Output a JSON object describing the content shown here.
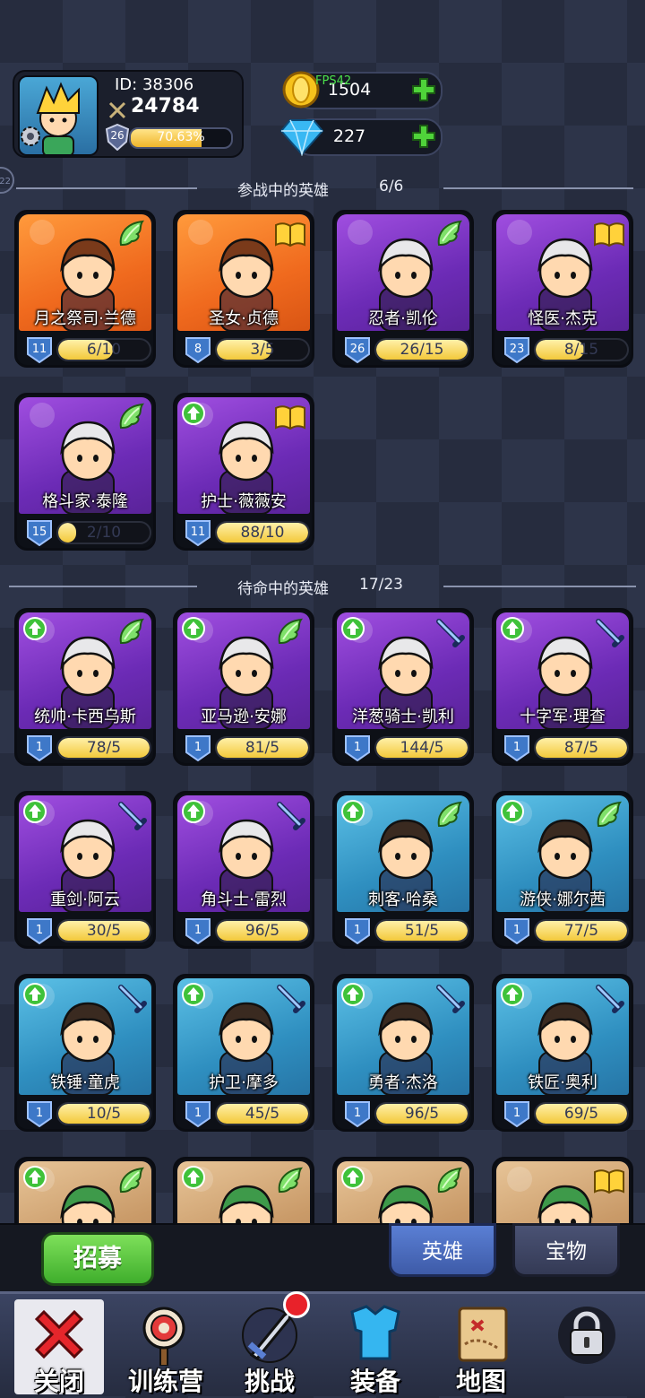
{
  "player": {
    "id_text": "ID:  38306",
    "power": "24784",
    "level": "26",
    "xp": "70.63%",
    "xp_fraction": 0.7063
  },
  "resources": {
    "gold": "1504",
    "gems": "227",
    "fps": "FPS42",
    "edge_label": "22"
  },
  "sections": {
    "active_title": "参战中的英雄",
    "active_count": "6/6",
    "standby_title": "待命中的英雄",
    "standby_count": "17/23"
  },
  "active_heroes": [
    {
      "name": "月之祭司·兰德",
      "level": "11",
      "progress": "6/10",
      "fill": 0.6,
      "bg": "orange",
      "badge": "wing",
      "up": false
    },
    {
      "name": "圣女·贞德",
      "level": "8",
      "progress": "3/5",
      "fill": 0.6,
      "bg": "orange",
      "badge": "book",
      "up": false
    },
    {
      "name": "忍者·凯伦",
      "level": "26",
      "progress": "26/15",
      "fill": 1,
      "bg": "purple",
      "badge": "wing",
      "up": false
    },
    {
      "name": "怪医·杰克",
      "level": "23",
      "progress": "8/15",
      "fill": 0.53,
      "bg": "purple",
      "badge": "book",
      "up": false
    },
    {
      "name": "格斗家·泰隆",
      "level": "15",
      "progress": "2/10",
      "fill": 0.2,
      "bg": "purple",
      "badge": "wing",
      "up": false
    },
    {
      "name": "护士·薇薇安",
      "level": "11",
      "progress": "88/10",
      "fill": 1,
      "bg": "purple",
      "badge": "book",
      "up": true
    }
  ],
  "standby_heroes": [
    {
      "name": "统帅·卡西乌斯",
      "level": "1",
      "progress": "78/5",
      "fill": 1,
      "bg": "purple",
      "badge": "wing",
      "up": true
    },
    {
      "name": "亚马逊·安娜",
      "level": "1",
      "progress": "81/5",
      "fill": 1,
      "bg": "purple",
      "badge": "wing",
      "up": true
    },
    {
      "name": "洋葱骑士·凯利",
      "level": "1",
      "progress": "144/5",
      "fill": 1,
      "bg": "purple",
      "badge": "sword",
      "up": true
    },
    {
      "name": "十字军·理查",
      "level": "1",
      "progress": "87/5",
      "fill": 1,
      "bg": "purple",
      "badge": "sword",
      "up": true
    },
    {
      "name": "重剑·阿云",
      "level": "1",
      "progress": "30/5",
      "fill": 1,
      "bg": "purple",
      "badge": "sword",
      "up": true
    },
    {
      "name": "角斗士·雷烈",
      "level": "1",
      "progress": "96/5",
      "fill": 1,
      "bg": "purple",
      "badge": "sword",
      "up": true
    },
    {
      "name": "刺客·哈桑",
      "level": "1",
      "progress": "51/5",
      "fill": 1,
      "bg": "blue",
      "badge": "wing",
      "up": true
    },
    {
      "name": "游侠·娜尔茜",
      "level": "1",
      "progress": "77/5",
      "fill": 1,
      "bg": "blue",
      "badge": "wing",
      "up": true
    },
    {
      "name": "铁锤·童虎",
      "level": "1",
      "progress": "10/5",
      "fill": 1,
      "bg": "blue",
      "badge": "sword",
      "up": true
    },
    {
      "name": "护卫·摩多",
      "level": "1",
      "progress": "45/5",
      "fill": 1,
      "bg": "blue",
      "badge": "sword",
      "up": true
    },
    {
      "name": "勇者·杰洛",
      "level": "1",
      "progress": "96/5",
      "fill": 1,
      "bg": "blue",
      "badge": "sword",
      "up": true
    },
    {
      "name": "铁匠·奥利",
      "level": "1",
      "progress": "69/5",
      "fill": 1,
      "bg": "blue",
      "badge": "sword",
      "up": true
    },
    {
      "name": "",
      "level": "",
      "progress": "",
      "fill": 0,
      "bg": "tan",
      "badge": "wing",
      "up": true
    },
    {
      "name": "",
      "level": "",
      "progress": "",
      "fill": 0,
      "bg": "tan",
      "badge": "wing",
      "up": true
    },
    {
      "name": "",
      "level": "",
      "progress": "",
      "fill": 0,
      "bg": "tan",
      "badge": "wing",
      "up": true
    },
    {
      "name": "",
      "level": "",
      "progress": "",
      "fill": 0,
      "bg": "tan",
      "badge": "book",
      "up": false
    }
  ],
  "actions": {
    "recruit": "招募",
    "tab_heroes": "英雄",
    "tab_treasure": "宝物"
  },
  "nav": [
    {
      "label": "关闭",
      "icon": "close-icon"
    },
    {
      "label": "训练营",
      "icon": "target-icon"
    },
    {
      "label": "挑战",
      "icon": "sword-icon"
    },
    {
      "label": "装备",
      "icon": "armor-icon"
    },
    {
      "label": "地图",
      "icon": "map-icon"
    },
    {
      "label": "",
      "icon": "lock-icon"
    }
  ],
  "colors": {
    "accent_green": "#3fae2c",
    "gold": "#f3c93b",
    "alert_red": "#e8222a"
  }
}
